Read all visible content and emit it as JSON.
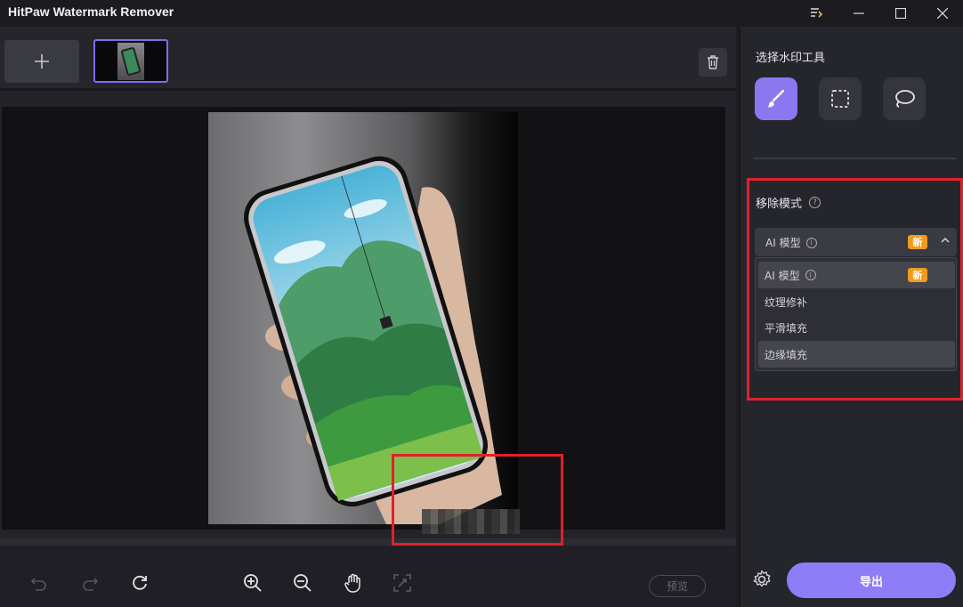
{
  "app": {
    "title": "HitPaw Watermark Remover"
  },
  "window_controls": [
    "pin-icon",
    "minimize-icon",
    "maximize-icon",
    "close-icon"
  ],
  "toolbar_top": {
    "add_icon": "plus-icon",
    "delete_icon": "trash-icon"
  },
  "editor": {
    "bottom_tools": [
      "undo-icon",
      "redo-icon",
      "refresh-icon",
      "zoom-in-icon",
      "zoom-out-icon",
      "hand-icon",
      "fit-screen-icon"
    ],
    "preview_label": "预览"
  },
  "right_panel": {
    "tool_section_title": "选择水印工具",
    "tools": [
      "brush-icon",
      "rect-select-icon",
      "lasso-icon"
    ],
    "mode_section_title": "移除模式",
    "selected_mode": "AI 模型",
    "new_badge": "新",
    "mode_options": [
      "AI 模型",
      "纹理修补",
      "平滑填充",
      "边缘填充"
    ],
    "export_label": "导出"
  },
  "colors": {
    "accent": "#8f7df7",
    "highlight_red": "#e0212a",
    "badge": "#f39a1c"
  }
}
